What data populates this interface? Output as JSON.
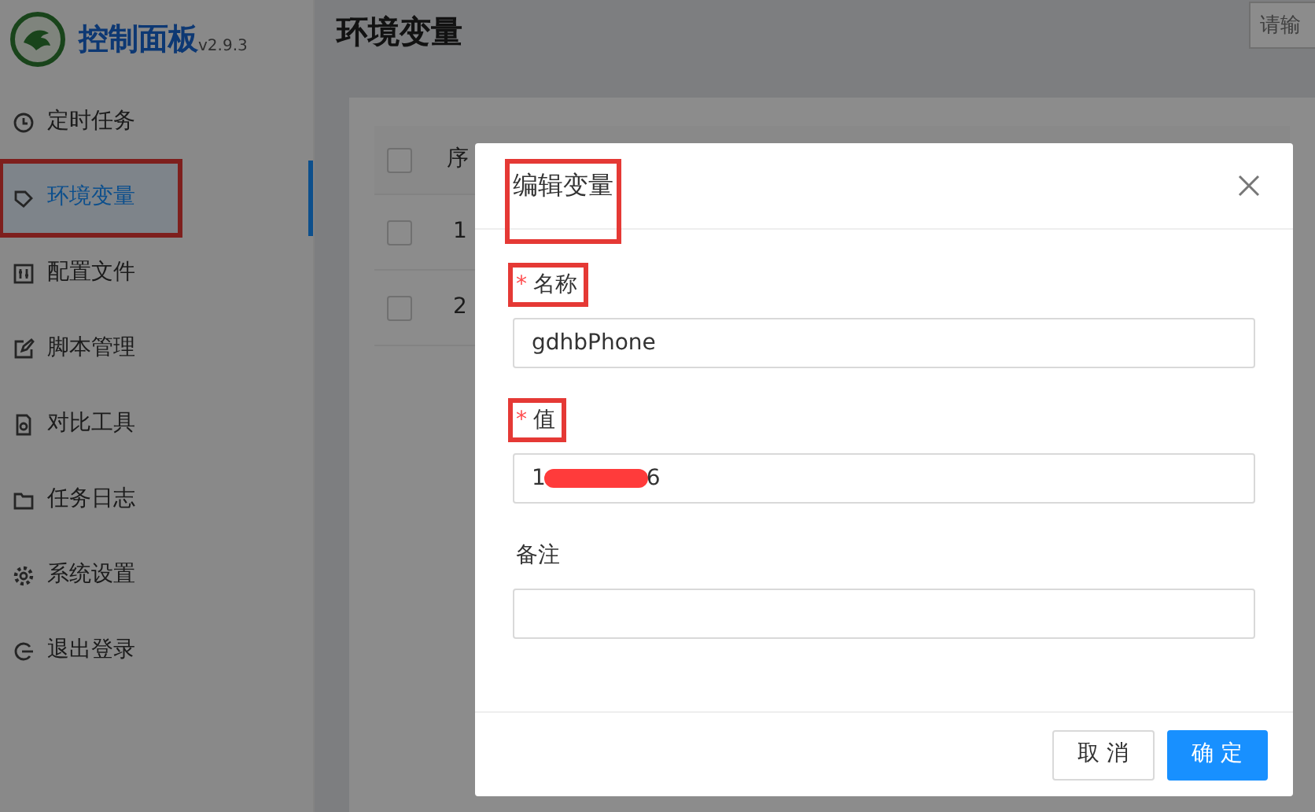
{
  "sidebar": {
    "brand": "控制面板",
    "version": "v2.9.3",
    "items": [
      {
        "label": "定时任务",
        "selected": false,
        "highlighted": false
      },
      {
        "label": "环境变量",
        "selected": true,
        "highlighted": true
      },
      {
        "label": "配置文件",
        "selected": false,
        "highlighted": false
      },
      {
        "label": "脚本管理",
        "selected": false,
        "highlighted": false
      },
      {
        "label": "对比工具",
        "selected": false,
        "highlighted": false
      },
      {
        "label": "任务日志",
        "selected": false,
        "highlighted": false
      },
      {
        "label": "系统设置",
        "selected": false,
        "highlighted": false
      },
      {
        "label": "退出登录",
        "selected": false,
        "highlighted": false
      }
    ]
  },
  "page": {
    "title": "环境变量",
    "search": {
      "placeholder": "请输"
    }
  },
  "table": {
    "header_checked": false,
    "columns": [
      "序"
    ],
    "rows": [
      {
        "index": "1",
        "checked": false
      },
      {
        "index": "2",
        "checked": false
      }
    ]
  },
  "dialog": {
    "title": "编辑变量",
    "title_highlighted": true,
    "fields": [
      {
        "label": "名称",
        "required_mark": "*",
        "highlighted": true,
        "value": "gdhbPhone"
      },
      {
        "label": "值",
        "required_mark": "*",
        "highlighted": true,
        "value": "1",
        "value_end": "6",
        "redacted": true
      },
      {
        "label": "备注",
        "highlighted": false
      }
    ],
    "buttons": [
      {
        "label": "取 消",
        "kind": "default"
      },
      {
        "label": "确 定",
        "kind": "primary"
      }
    ]
  }
}
